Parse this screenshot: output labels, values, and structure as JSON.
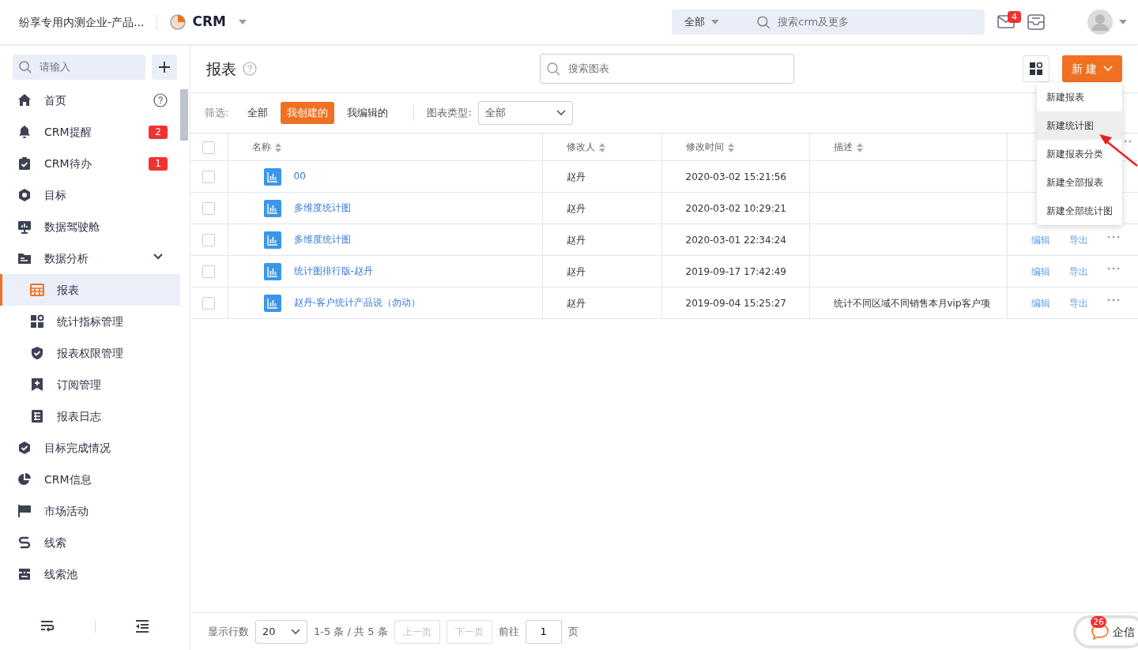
{
  "topbar": {
    "company": "纷享专用内测企业-产品...",
    "app": "CRM",
    "search_scope": "全部",
    "search_placeholder": "搜索crm及更多",
    "mail_count": "4"
  },
  "sidebar": {
    "search_placeholder": "请输入",
    "items": [
      {
        "label": "首页",
        "selected": false,
        "help": true
      },
      {
        "label": "CRM提醒",
        "selected": false,
        "badge": "2"
      },
      {
        "label": "CRM待办",
        "selected": false,
        "badge": "1"
      },
      {
        "label": "目标",
        "selected": false
      },
      {
        "label": "数据驾驶舱",
        "selected": false
      },
      {
        "label": "数据分析",
        "selected": false,
        "expanded": true,
        "children": [
          {
            "label": "报表",
            "selected": true
          },
          {
            "label": "统计指标管理",
            "selected": false
          },
          {
            "label": "报表权限管理",
            "selected": false
          },
          {
            "label": "订阅管理",
            "selected": false
          },
          {
            "label": "报表日志",
            "selected": false
          }
        ]
      },
      {
        "label": "目标完成情况",
        "selected": false
      },
      {
        "label": "CRM信息",
        "selected": false
      },
      {
        "label": "市场活动",
        "selected": false
      },
      {
        "label": "线索",
        "selected": false
      },
      {
        "label": "线索池",
        "selected": false
      }
    ]
  },
  "page": {
    "title": "报表",
    "search_placeholder": "搜索图表",
    "new_button": "新 建",
    "new_menu": [
      {
        "label": "新建报表",
        "selected": false
      },
      {
        "label": "新建统计图",
        "selected": true
      },
      {
        "label": "新建报表分类",
        "selected": false
      },
      {
        "label": "新建全部报表",
        "selected": false
      },
      {
        "label": "新建全部统计图",
        "selected": false
      }
    ]
  },
  "filter": {
    "label": "筛选:",
    "options": [
      {
        "label": "全部",
        "selected": false
      },
      {
        "label": "我创建的",
        "selected": true
      },
      {
        "label": "我编辑的",
        "selected": false
      }
    ],
    "chart_type_label": "图表类型:",
    "chart_type_value": "全部"
  },
  "table": {
    "all_checked": false,
    "columns": [
      "名称",
      "修改人",
      "修改时间",
      "描述"
    ],
    "rows": [
      {
        "name": "00",
        "editor": "赵丹",
        "time": "2020-03-02 15:21:56",
        "checked": false
      },
      {
        "name": "多维度统计图",
        "editor": "赵丹",
        "time": "2020-03-02 10:29:21",
        "checked": false
      },
      {
        "name": "多维度统计图",
        "editor": "赵丹",
        "time": "2020-03-01 22:34:24",
        "checked": false,
        "actions": [
          "编辑",
          "导出"
        ]
      },
      {
        "name": "统计图排行版-赵丹",
        "editor": "赵丹",
        "time": "2019-09-17 17:42:49",
        "checked": false,
        "actions": [
          "编辑",
          "导出"
        ]
      },
      {
        "name": "赵丹-客户统计产品说（勿动）",
        "editor": "赵丹",
        "time": "2019-09-04 15:25:27",
        "description": "统计不同区域不同销售本月vip客户项",
        "checked": false,
        "actions": [
          "编辑",
          "导出"
        ]
      }
    ]
  },
  "pager": {
    "rows_label": "显示行数",
    "rows_value": "20",
    "summary": "1-5 条 / 共 5 条",
    "prev": "上一页",
    "next": "下一页",
    "goto_label": "前往",
    "page": "1",
    "page_suffix": "页"
  },
  "chat": {
    "count": "26",
    "label": "企信"
  }
}
